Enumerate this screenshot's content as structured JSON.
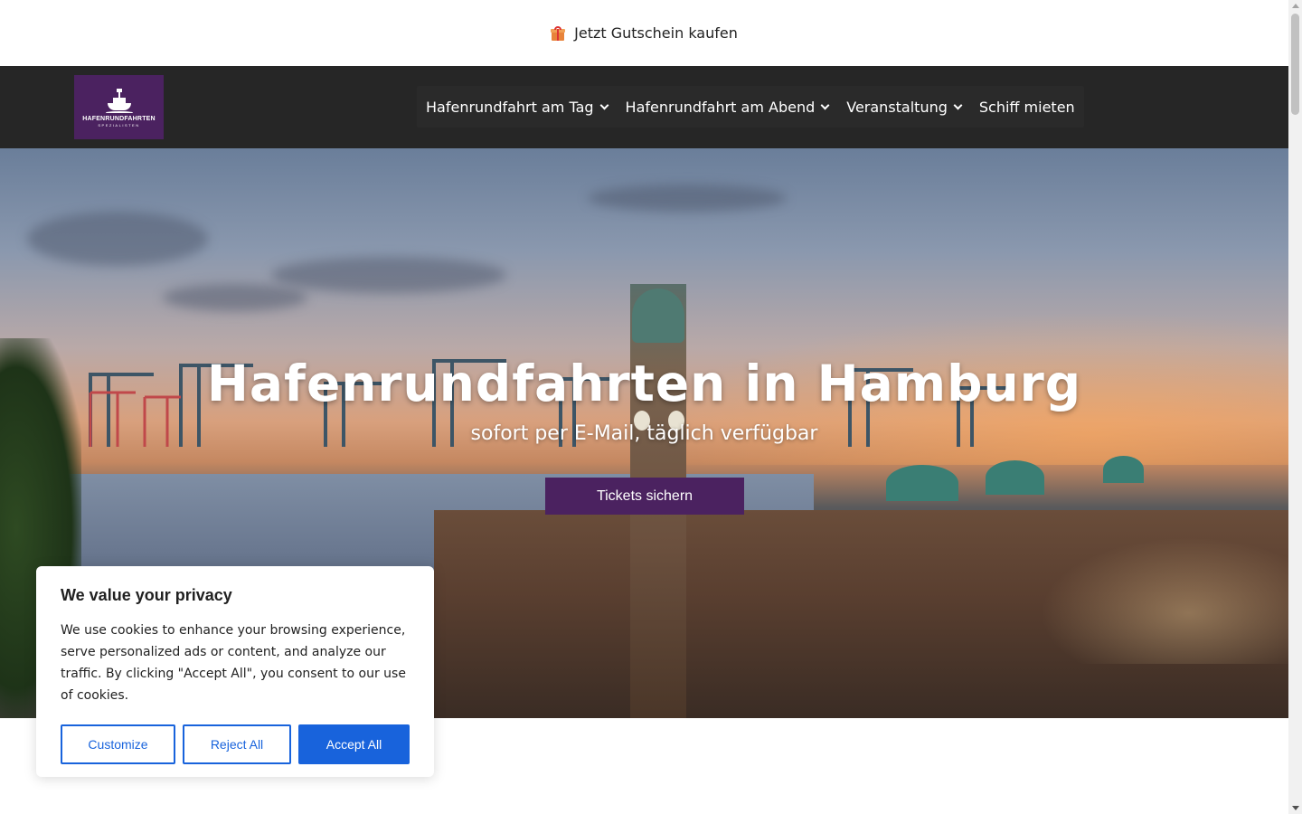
{
  "promo": {
    "gift_icon": "gift-icon",
    "label": "Jetzt Gutschein kaufen"
  },
  "header": {
    "logo": {
      "name": "HAFENRUNDFAHRTEN",
      "sub": "SPEZIALISTEN",
      "bg_color": "#4b2260"
    },
    "nav": [
      {
        "label": "Hafenrundfahrt am Tag",
        "has_dropdown": true
      },
      {
        "label": "Hafenrundfahrt am Abend",
        "has_dropdown": true
      },
      {
        "label": "Veranstaltung",
        "has_dropdown": true
      },
      {
        "label": "Schiff mieten",
        "has_dropdown": false
      }
    ]
  },
  "hero": {
    "title": "Hafenrundfahrten in Hamburg",
    "subtitle": "sofort per E-Mail, täglich verfügbar",
    "cta": "Tickets sichern",
    "cta_color": "#4b2260"
  },
  "cookie": {
    "title": "We value your privacy",
    "text": "We use cookies to enhance your browsing experience, serve personalized ads or content, and analyze our traffic. By clicking \"Accept All\", you consent to our use of cookies.",
    "customize": "Customize",
    "reject": "Reject All",
    "accept": "Accept All",
    "accent_color": "#1863dc"
  }
}
